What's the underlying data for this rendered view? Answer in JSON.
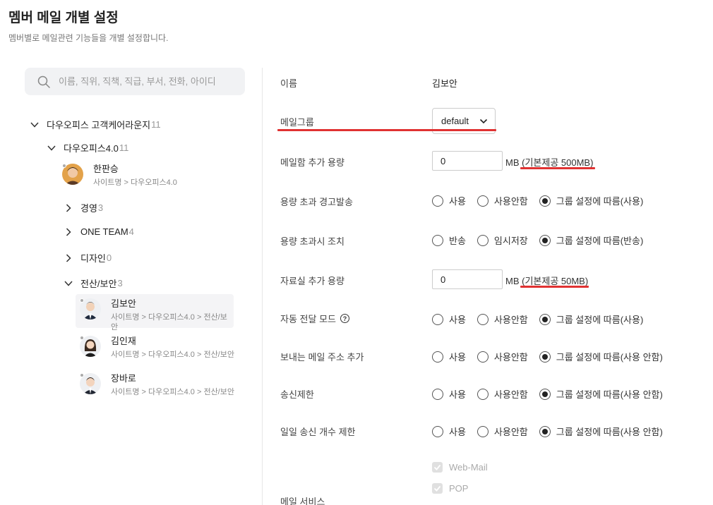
{
  "header": {
    "title": "멤버 메일 개별 설정",
    "description": "멤버별로 메일관련 기능들을 개별 설정합니다."
  },
  "search": {
    "placeholder": "이름, 직위, 직책, 직급, 부서, 전화, 아이디"
  },
  "tree": {
    "root": {
      "label": "다우오피스 고객케어라운지",
      "count": "11"
    },
    "dept": {
      "label": "다우오피스4.0",
      "count": "11"
    },
    "top_member": {
      "name": "한판승",
      "path": "사이트명 > 다우오피스4.0"
    },
    "groups": [
      {
        "label": "경영",
        "count": "3"
      },
      {
        "label": "ONE TEAM",
        "count": "4"
      },
      {
        "label": "디자인",
        "count": "0"
      },
      {
        "label": "전산/보안",
        "count": "3"
      }
    ],
    "members": [
      {
        "name": "김보안",
        "path": "사이트명 > 다우오피스4.0 > 전산/보안"
      },
      {
        "name": "김인재",
        "path": "사이트명 > 다우오피스4.0 > 전산/보안"
      },
      {
        "name": "장바로",
        "path": "사이트명 > 다우오피스4.0 > 전산/보안"
      }
    ]
  },
  "form": {
    "name_label": "이름",
    "name_value": "김보안",
    "mail_group_label": "메일그룹",
    "mail_group_value": "default",
    "mailbox_capacity_label": "메일함 추가 용량",
    "mailbox_capacity_value": "0",
    "mailbox_capacity_unit": "MB (기본제공 500MB)",
    "over_warning_label": "용량 초과 경고발송",
    "over_action_label": "용량 초과시 조치",
    "archive_capacity_label": "자료실 추가 용량",
    "archive_capacity_value": "0",
    "archive_capacity_unit": "MB (기본제공 50MB)",
    "auto_forward_label": "자동 전달 모드",
    "sender_address_label": "보내는 메일 주소 추가",
    "send_limit_label": "송신제한",
    "daily_send_limit_label": "일일 송신 개수 제한",
    "mail_service_label": "메일 서비스",
    "opt_use": "사용",
    "opt_notuse": "사용안함",
    "opt_group_use": "그룹 설정에 따름(사용)",
    "opt_return": "반송",
    "opt_temp_save": "임시저장",
    "opt_group_return": "그룹 설정에 따름(반송)",
    "opt_group_notuse": "그룹 설정에 따름(사용 안함)",
    "svc_webmail": "Web-Mail",
    "svc_pop": "POP"
  },
  "colors": {
    "highlight": "#e03232"
  },
  "icons": {
    "search": "search-icon",
    "chevron_down": "chevron-down-icon",
    "chevron_right": "chevron-right-icon",
    "help": "help-circle-icon"
  }
}
